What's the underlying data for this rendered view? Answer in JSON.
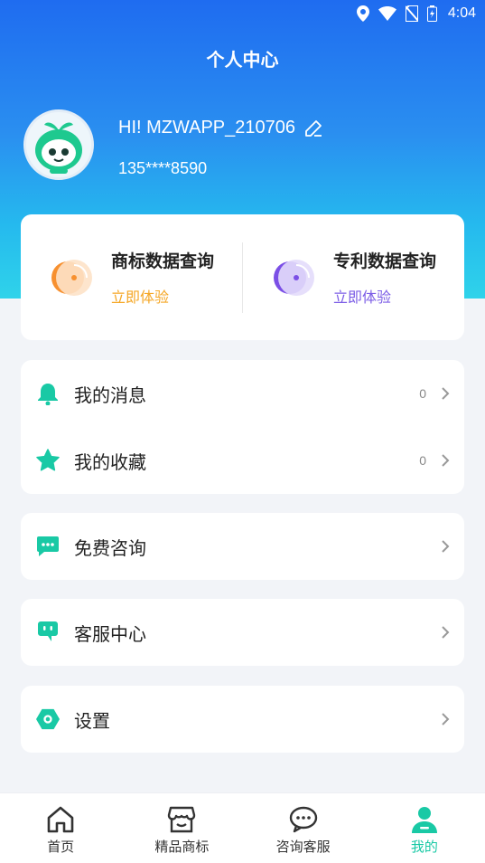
{
  "status_bar": {
    "time": "4:04"
  },
  "header": {
    "title": "个人中心"
  },
  "profile": {
    "username": "HI! MZWAPP_210706",
    "phone": "135****8590"
  },
  "query_cards": [
    {
      "title": "商标数据查询",
      "action": "立即体验",
      "accent": "#f5a623"
    },
    {
      "title": "专利数据查询",
      "action": "立即体验",
      "accent": "#7b5ce6"
    }
  ],
  "menu": {
    "messages": {
      "label": "我的消息",
      "count": "0"
    },
    "favorites": {
      "label": "我的收藏",
      "count": "0"
    },
    "consult": {
      "label": "免费咨询"
    },
    "service": {
      "label": "客服中心"
    },
    "settings": {
      "label": "设置"
    }
  },
  "tabbar": {
    "items": [
      {
        "label": "首页",
        "icon": "home-icon"
      },
      {
        "label": "精品商标",
        "icon": "store-icon"
      },
      {
        "label": "咨询客服",
        "icon": "chat-icon"
      },
      {
        "label": "我的",
        "icon": "user-icon",
        "active": true
      }
    ]
  },
  "colors": {
    "accent": "#19c9a5",
    "hero_top": "#1f6cf0",
    "hero_bottom": "#2fd3ea"
  }
}
